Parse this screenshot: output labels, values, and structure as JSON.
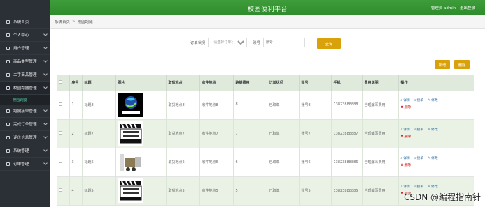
{
  "header": {
    "title": "校园便利平台",
    "user": "管理员 admin",
    "logout": "退出登录"
  },
  "breadcrumb": {
    "home": "系统首页",
    "sep": ">",
    "current": "校园跑腿"
  },
  "sidebar": {
    "items": [
      {
        "label": "系统首页",
        "icon": "home-icon",
        "expand": false
      },
      {
        "label": "个人中心",
        "icon": "user-icon",
        "expand": true
      },
      {
        "label": "用户管理",
        "icon": "users-icon",
        "expand": true
      },
      {
        "label": "商品类型管理",
        "icon": "list-icon",
        "expand": true
      },
      {
        "label": "二手商品管理",
        "icon": "box-icon",
        "expand": true
      },
      {
        "label": "校园跑腿管理",
        "icon": "run-icon",
        "expand": true,
        "active": true
      },
      {
        "label": "跑腿接单管理",
        "icon": "order-icon",
        "expand": true
      },
      {
        "label": "完成订单管理",
        "icon": "check-icon",
        "expand": true
      },
      {
        "label": "评价信息管理",
        "icon": "comment-icon",
        "expand": true
      },
      {
        "label": "系统管理",
        "icon": "settings-icon",
        "expand": true
      },
      {
        "label": "订单管理",
        "icon": "cart-icon",
        "expand": true
      }
    ],
    "sub_item": "校园跑腿"
  },
  "search": {
    "status_label": "订单状况",
    "status_placeholder": "请选择订单状况",
    "account_label": "账号",
    "account_placeholder": "账号",
    "search_button": "查询"
  },
  "toolbar": {
    "add": "新增",
    "delete": "删除"
  },
  "table": {
    "columns": [
      "",
      "序号",
      "标题",
      "图片",
      "取货地点",
      "收件地点",
      "跑腿费用",
      "订单状况",
      "账号",
      "手机",
      "费用说明",
      "操作"
    ],
    "rows": [
      {
        "idx": "1",
        "title": "标题8",
        "pickup": "取货地点8",
        "deliver": "收件地点8",
        "fee": "8",
        "status": "已取单",
        "account": "账号8",
        "phone": "13823888888",
        "fee_desc": "合理编写费用",
        "img": "logo"
      },
      {
        "idx": "2",
        "title": "标题7",
        "pickup": "取货地点7",
        "deliver": "收件地点7",
        "fee": "7",
        "status": "已取单",
        "account": "账号7",
        "phone": "13823888887",
        "fee_desc": "合理编写费用",
        "img": "clapper"
      },
      {
        "idx": "3",
        "title": "标题6",
        "pickup": "取货地点6",
        "deliver": "收件地点6",
        "fee": "6",
        "status": "已取单",
        "account": "账号6",
        "phone": "13823888886",
        "fee_desc": "合理编写费用",
        "img": "robot"
      },
      {
        "idx": "4",
        "title": "标题5",
        "pickup": "取货地点5",
        "deliver": "收件地点5",
        "fee": "5",
        "status": "已取单",
        "account": "账号5",
        "phone": "13823888885",
        "fee_desc": "合理编写费用",
        "img": "clapper"
      }
    ],
    "ops": {
      "detail": "详情",
      "receive": "接单",
      "edit": "修改",
      "delete": "删除"
    }
  },
  "watermark": "CSDN @编程指南针",
  "colors": {
    "header": "#2f8b2c",
    "sidebar": "#2b2f36",
    "button": "#d9a20b",
    "row_alt": "#e9f2e5",
    "th": "#dfe9dc"
  }
}
